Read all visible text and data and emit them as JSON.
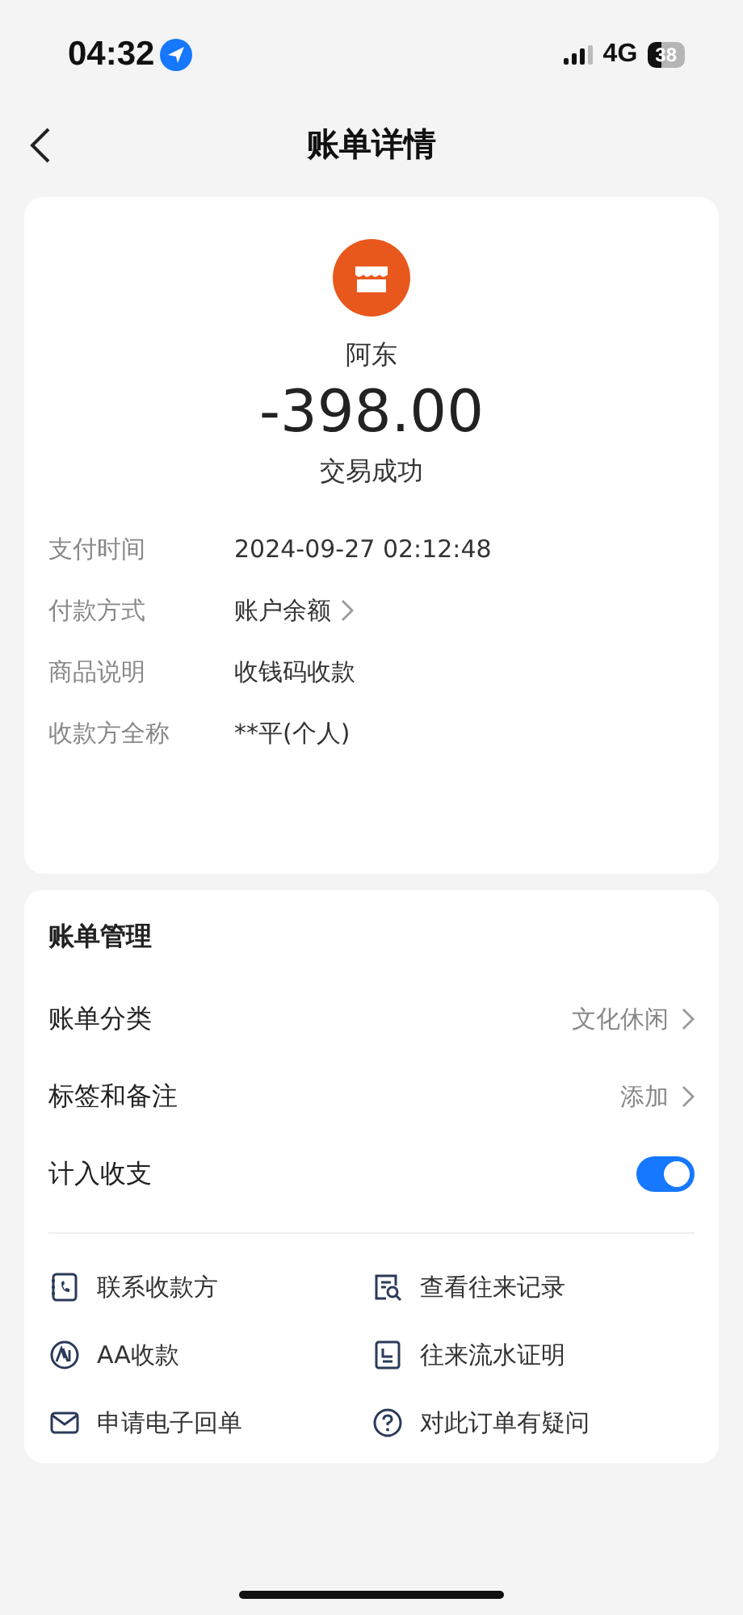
{
  "status_bar": {
    "time": "04:32",
    "network": "4G",
    "battery": "38"
  },
  "nav": {
    "title": "账单详情"
  },
  "summary": {
    "payee": "阿东",
    "amount": "-398.00",
    "status": "交易成功"
  },
  "details": [
    {
      "label": "支付时间",
      "value": "2024-09-27 02:12:48",
      "link": false
    },
    {
      "label": "付款方式",
      "value": "账户余额",
      "link": true
    },
    {
      "label": "商品说明",
      "value": "收钱码收款",
      "link": false
    },
    {
      "label": "收款方全称",
      "value": "**平(个人)",
      "link": false
    }
  ],
  "management": {
    "title": "账单管理",
    "rows": [
      {
        "kind": "link",
        "label": "账单分类",
        "value": "文化休闲"
      },
      {
        "kind": "link",
        "label": "标签和备注",
        "value": "添加"
      },
      {
        "kind": "toggle",
        "label": "计入收支",
        "on": true
      }
    ]
  },
  "actions": [
    {
      "kind": "phone",
      "label": "联系收款方"
    },
    {
      "kind": "search",
      "label": "查看往来记录"
    },
    {
      "kind": "aa",
      "label": "AA收款"
    },
    {
      "kind": "doc",
      "label": "往来流水证明"
    },
    {
      "kind": "mail",
      "label": "申请电子回单"
    },
    {
      "kind": "help",
      "label": "对此订单有疑问"
    }
  ]
}
